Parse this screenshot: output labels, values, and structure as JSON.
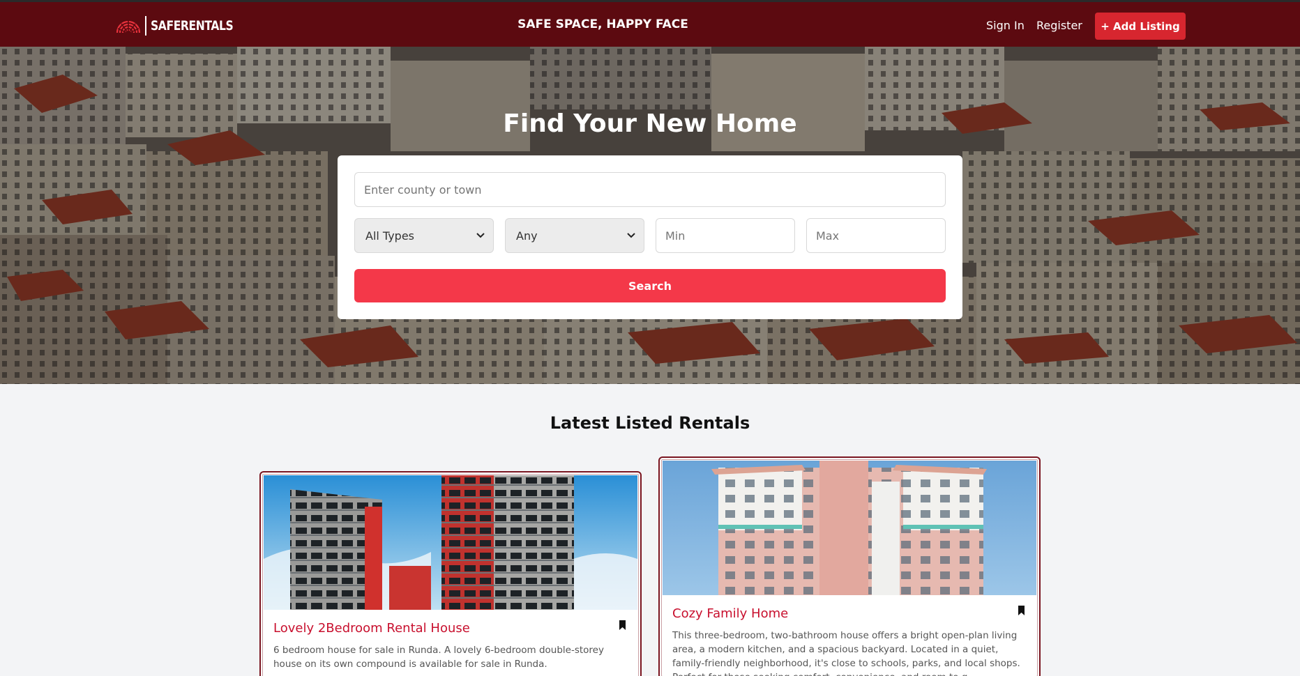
{
  "navbar": {
    "brand_name": "SAFERENTALS",
    "tagline": "SAFE SPACE, HAPPY FACE",
    "links": {
      "sign_in": "Sign In",
      "register": "Register"
    },
    "add_listing_label": "+ Add Listing"
  },
  "hero": {
    "title": "Find Your New Home",
    "search": {
      "location_placeholder": "Enter county or town",
      "type_selected": "All Types",
      "bedrooms_selected": "Any",
      "min_placeholder": "Min",
      "max_placeholder": "Max",
      "search_button": "Search"
    }
  },
  "listings": {
    "section_title": "Latest Listed Rentals",
    "items": [
      {
        "title": "Lovely 2Bedroom Rental House",
        "description": "6 bedroom house for sale in Runda. A lovely 6-bedroom double-storey house on its own compound is available for sale in Runda."
      },
      {
        "title": "Cozy Family Home",
        "description": "This three-bedroom, two-bathroom house offers a bright open-plan living area, a modern kitchen, and a spacious backyard. Located in a quiet, family-friendly neighborhood, it's close to schools, parks, and local shops. Perfect for those seeking comfort, convenience, and room to g..."
      }
    ]
  },
  "colors": {
    "navbar_bg": "#5c0a10",
    "accent_red": "#f43849",
    "add_button": "#d7262f",
    "card_title": "#c8102e"
  },
  "icons": [
    "sunrise-logo-icon",
    "chevron-down-icon",
    "bookmark-icon"
  ]
}
